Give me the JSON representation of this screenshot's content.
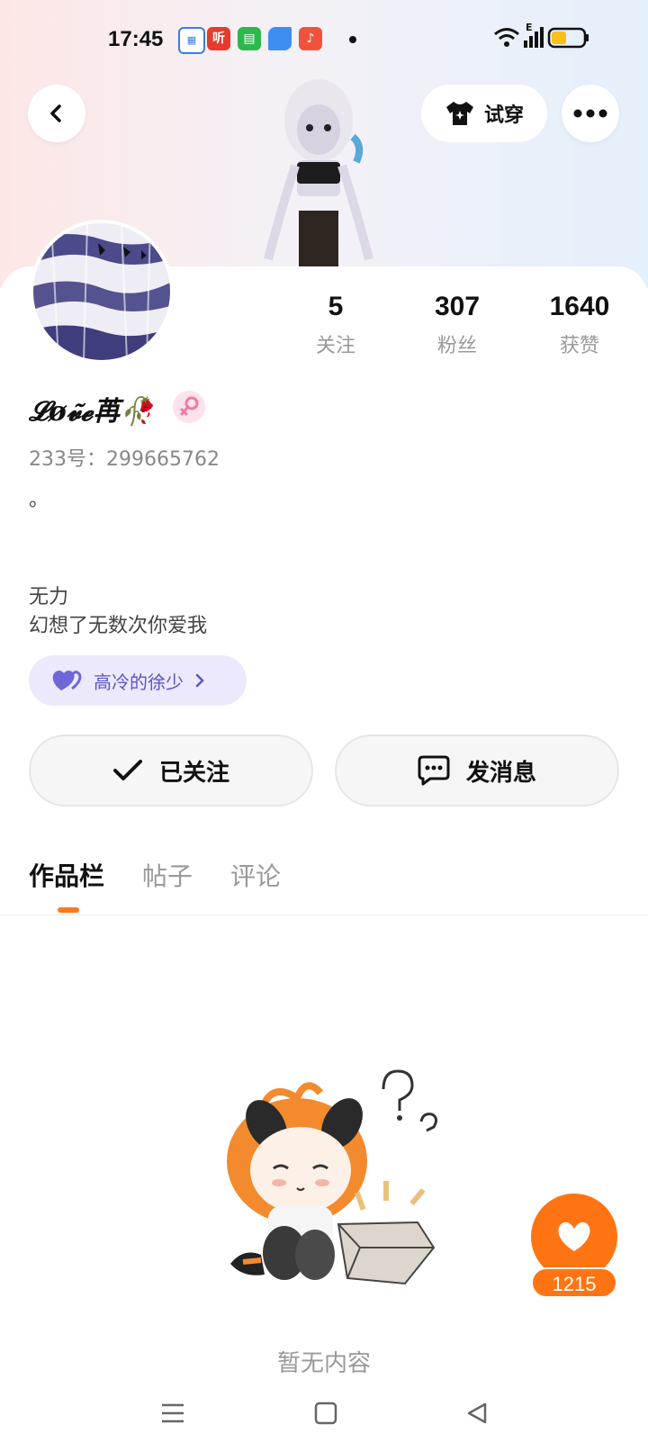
{
  "status_bar": {
    "time": "17:45",
    "app_icons": [
      "calendar-app-icon",
      "ting-app-icon",
      "green-app-icon",
      "blue-app-icon",
      "music-app-icon"
    ],
    "ting_label": "听",
    "network_label": "E"
  },
  "header": {
    "back_icon": "chevron-left-icon",
    "try_on_label": "试穿",
    "more_icon": "more-dots-icon"
  },
  "profile": {
    "stats": [
      {
        "value": "5",
        "label": "关注"
      },
      {
        "value": "307",
        "label": "粉丝"
      },
      {
        "value": "1640",
        "label": "获赞"
      }
    ],
    "nickname": "𝓛ø𝓿̃𝓮苒🥀",
    "gender_icon": "female-icon",
    "uid": "233号：299665762",
    "bio_line1": "。",
    "bio_line2": "无力",
    "bio_line3": "幻想了无数次你爱我",
    "cp_tag": "高冷的徐少"
  },
  "actions": {
    "follow_label": "已关注",
    "message_label": "发消息"
  },
  "tabs": [
    {
      "label": "作品栏",
      "active": true
    },
    {
      "label": "帖子",
      "active": false
    },
    {
      "label": "评论",
      "active": false
    }
  ],
  "empty_state": {
    "text": "暂无内容"
  },
  "like_fab": {
    "count": "1215"
  },
  "colors": {
    "accent": "#ff7412",
    "tag_bg": "#ebe9fb",
    "tag_text": "#5b55c4"
  }
}
